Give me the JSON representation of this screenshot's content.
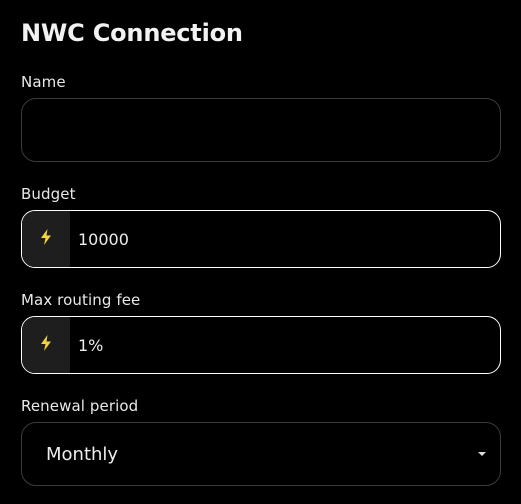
{
  "form": {
    "title": "NWC Connection",
    "name": {
      "label": "Name",
      "value": "",
      "placeholder": ""
    },
    "budget": {
      "label": "Budget",
      "icon": "lightning-icon",
      "value": "10000"
    },
    "max_routing_fee": {
      "label": "Max routing fee",
      "icon": "lightning-icon",
      "value": "1%"
    },
    "renewal_period": {
      "label": "Renewal period",
      "selected": "Monthly"
    }
  },
  "colors": {
    "background": "#000000",
    "bolt": "#f6d23c",
    "addon_background": "#1e1e1e",
    "focused_border": "#ffffff",
    "idle_border": "#3c3c3c"
  }
}
